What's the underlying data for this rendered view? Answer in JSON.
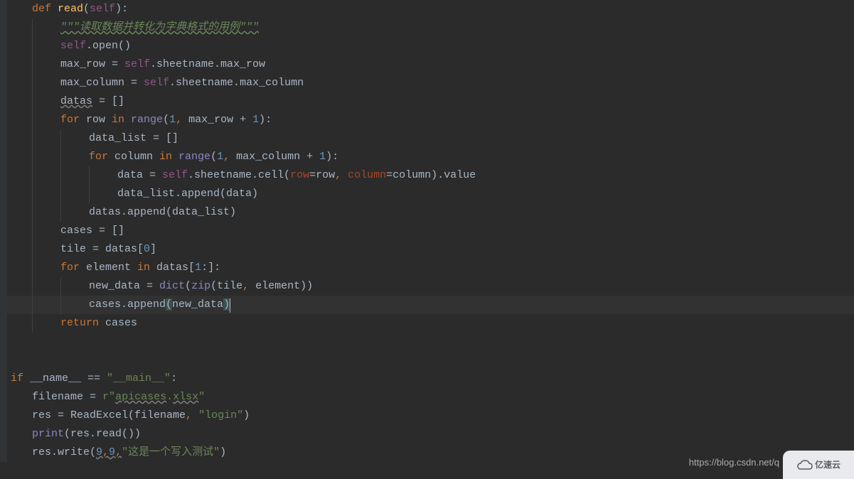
{
  "code": {
    "l1": {
      "def": "def ",
      "fn": "read",
      "p1": "(",
      "self": "self",
      "p2": "):"
    },
    "l2": {
      "doc": "\"\"\"读取数据并转化为字典格式的用例\"\"\""
    },
    "l3": {
      "self": "self",
      "rest": ".open()"
    },
    "l4": {
      "v1": "max_row = ",
      "self": "self",
      "rest": ".sheetname.max_row"
    },
    "l5": {
      "v1": "max_column = ",
      "self": "self",
      "rest": ".sheetname.max_column"
    },
    "l6": {
      "v1": "datas",
      "rest": " = []"
    },
    "l7": {
      "for": "for ",
      "v1": "row ",
      "in": "in ",
      "range": "range",
      "p1": "(",
      "n1": "1",
      "c": ", ",
      "v2": "max_row + ",
      "n2": "1",
      "p2": "):"
    },
    "l8": {
      "rest": "data_list = []"
    },
    "l9": {
      "for": "for ",
      "v1": "column ",
      "in": "in ",
      "range": "range",
      "p1": "(",
      "n1": "1",
      "c": ", ",
      "v2": "max_column + ",
      "n2": "1",
      "p2": "):"
    },
    "l10": {
      "v1": "data = ",
      "self": "self",
      "v2": ".sheetname.cell(",
      "p1": "row",
      "v3": "=row",
      "c": ", ",
      "p2": "column",
      "v4": "=column).value"
    },
    "l11": {
      "rest": "data_list.append(data)"
    },
    "l12": {
      "rest": "datas.append(data_list)"
    },
    "l13": {
      "rest": "cases = []"
    },
    "l14": {
      "v1": "tile = datas[",
      "n1": "0",
      "v2": "]"
    },
    "l15": {
      "for": "for ",
      "v1": "element ",
      "in": "in ",
      "v2": "datas[",
      "n1": "1",
      "v3": ":]:"
    },
    "l16": {
      "v1": "new_data = ",
      "dict": "dict",
      "p1": "(",
      "zip": "zip",
      "p2": "(tile",
      "c": ", ",
      "v2": "element))"
    },
    "l17": {
      "v1": "cases.append",
      "pm1": "(",
      "v2": "new_data",
      "pm2": ")"
    },
    "l18": {
      "ret": "return ",
      "v1": "cases"
    },
    "l21": {
      "if": "if ",
      "v1": "__name__ == ",
      "str": "\"__main__\"",
      "p": ":"
    },
    "l22": {
      "v1": "filename = ",
      "r": "r",
      "q1": "\"",
      "str": "apicases",
      "dot": ".",
      "str2": "xlsx",
      "q2": "\""
    },
    "l23": {
      "v1": "res = ReadExcel(filename",
      "c": ", ",
      "str": "\"login\"",
      "p": ")"
    },
    "l24": {
      "print": "print",
      "rest": "(res.read())"
    },
    "l25": {
      "v1": "res.write(",
      "n1": "9",
      "c1": ",",
      "n2": "9",
      "c2": ",",
      "str": "\"这是一个写入测试\"",
      "p": ")"
    }
  },
  "watermark": {
    "url": "https://blog.csdn.net/q",
    "logo": "亿速云"
  }
}
